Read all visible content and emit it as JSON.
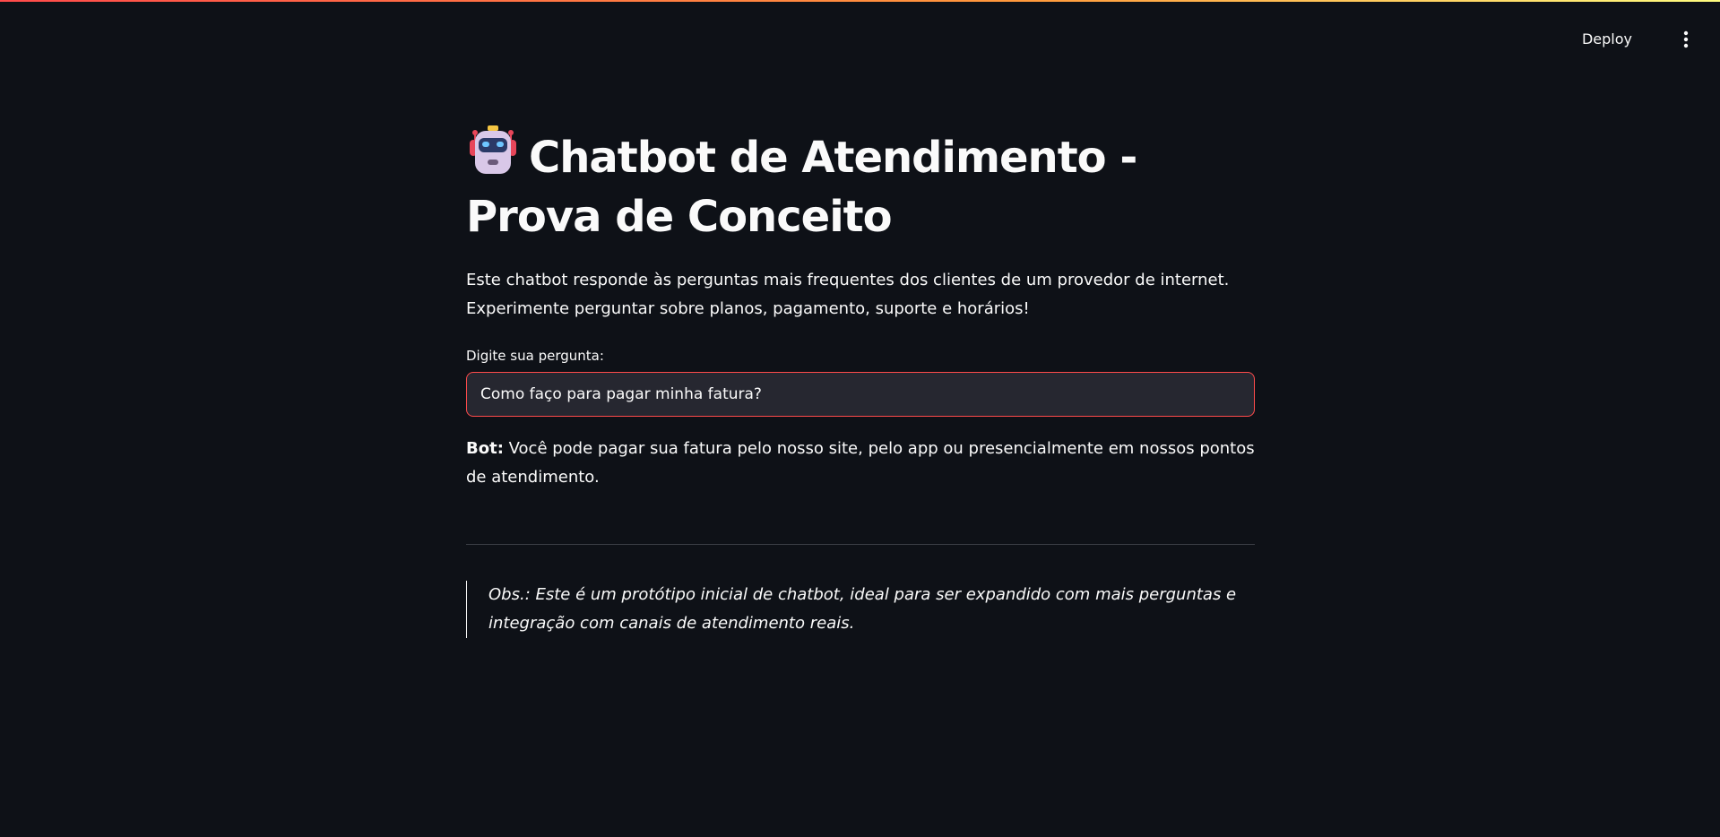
{
  "header": {
    "deploy_label": "Deploy",
    "menu_icon": "more-vertical-icon"
  },
  "colors": {
    "background": "#0e1117",
    "input_background": "#262730",
    "input_border": "#ff4b4b",
    "text": "#fafafa",
    "accent": "#ff4b4b"
  },
  "main": {
    "title_icon": "robot-icon",
    "title": "Chatbot de Atendimento - Prova de Conceito",
    "description": "Este chatbot responde às perguntas mais frequentes dos clientes de um provedor de internet. Experimente perguntar sobre planos, pagamento, suporte e horários!",
    "input_label": "Digite sua pergunta:",
    "input_value": "Como faço para pagar minha fatura?",
    "bot_prefix": "Bot:",
    "bot_answer": "Você pode pagar sua fatura pelo nosso site, pelo app ou presencialmente em nossos pontos de atendimento.",
    "note": "Obs.: Este é um protótipo inicial de chatbot, ideal para ser expandido com mais perguntas e integração com canais de atendimento reais."
  }
}
